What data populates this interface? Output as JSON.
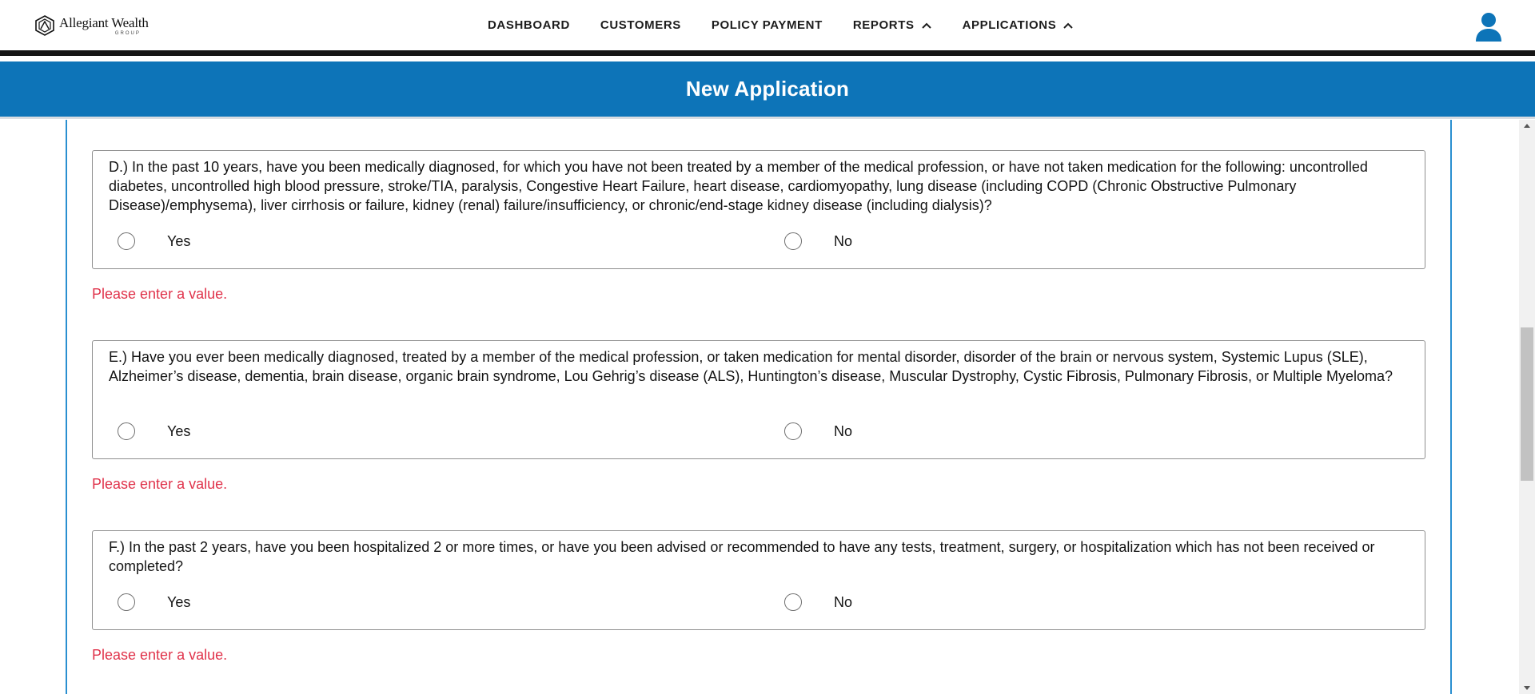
{
  "header": {
    "logo_name": "Allegiant Wealth",
    "logo_sub": "GROUP",
    "nav": [
      {
        "label": "DASHBOARD"
      },
      {
        "label": "CUSTOMERS"
      },
      {
        "label": "POLICY PAYMENT"
      },
      {
        "label": "REPORTS"
      },
      {
        "label": "APPLICATIONS"
      }
    ],
    "user_icon": "user-icon"
  },
  "banner": {
    "title": "New Application"
  },
  "questions": [
    {
      "text": "D.) In the past 10 years, have you been medically diagnosed, for which you have not been treated by a member of the medical profession, or have not taken medication for the following: uncontrolled diabetes, uncontrolled high blood pressure, stroke/TIA, paralysis, Congestive Heart Failure, heart disease, cardiomyopathy, lung disease (including COPD (Chronic Obstructive Pulmonary Disease)/emphysema), liver cirrhosis or failure, kidney (renal) failure/insufficiency, or chronic/end-stage kidney disease (including dialysis)?",
      "yes": "Yes",
      "no": "No",
      "error": "Please enter a value."
    },
    {
      "text": "E.) Have you ever been medically diagnosed, treated by a member of the medical profession, or taken medication for mental disorder, disorder of the brain or nervous system, Systemic Lupus (SLE), Alzheimer’s disease, dementia, brain disease, organic brain syndrome, Lou Gehrig’s disease (ALS), Huntington’s disease, Muscular Dystrophy, Cystic Fibrosis, Pulmonary Fibrosis, or Multiple Myeloma?",
      "yes": "Yes",
      "no": "No",
      "error": "Please enter a value."
    },
    {
      "text": "F.) In the past 2 years, have you been hospitalized 2 or more times, or have you been advised or recommended to have any tests, treatment, surgery, or hospitalization which has not been received or completed?",
      "yes": "Yes",
      "no": "No",
      "error": "Please enter a value."
    }
  ],
  "colors": {
    "banner": "#0d74b8",
    "error": "#e0334b",
    "frame_border": "#2a8fd0"
  }
}
